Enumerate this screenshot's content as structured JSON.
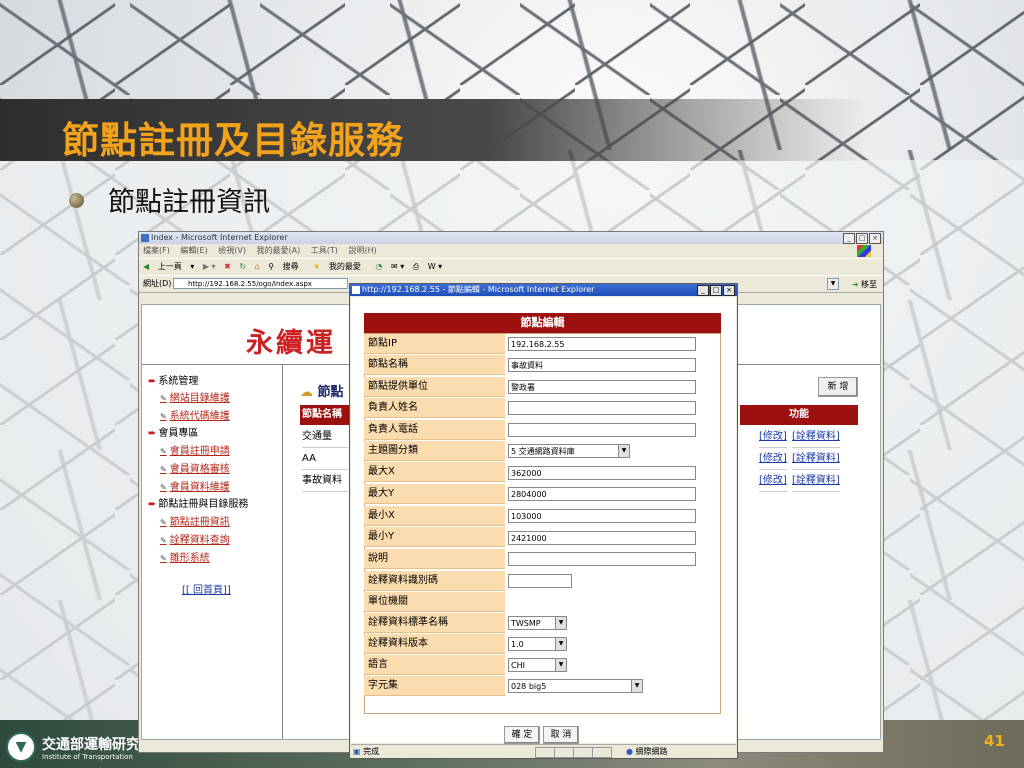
{
  "slide": {
    "title": "節點註冊及目錄服務",
    "bullet": "節點註冊資訊",
    "footer_org": "交通部運輸研究",
    "footer_org_en": "Institute of Transportation",
    "page_number": "41"
  },
  "ie_window": {
    "title": "Index - Microsoft Internet Explorer",
    "menu": [
      "檔案(F)",
      "編輯(E)",
      "檢視(V)",
      "我的最愛(A)",
      "工具(T)",
      "說明(H)"
    ],
    "toolbar": {
      "back": "上一頁",
      "search": "搜尋",
      "favorites": "我的最愛"
    },
    "address_label": "網址(D)",
    "address_url": "http://192.168.2.55/ogo/Index.aspx",
    "go_label": "移至",
    "banner_title": "永續運",
    "nav": {
      "system_mgmt": "系統管理",
      "site_directory": "網站目錄維護",
      "system_code": "系統代碼維護",
      "member_area": "會員專區",
      "member_register": "會員註冊申請",
      "member_review": "會員資格審核",
      "member_maintain": "會員資料維護",
      "node_reg_dir": "節點註冊與目錄服務",
      "node_reg_info": "節點註冊資訊",
      "metadata_query": "詮釋資料查詢",
      "geo_system": "雛形系統",
      "home_link": "[[ 回首頁]]"
    },
    "section_title": "節點",
    "new_button": "新 增",
    "table": {
      "col_node_name": "節點名稱",
      "col_function": "功能",
      "rows": [
        {
          "name": "交通量",
          "edit": "[修改]",
          "meta": "[詮釋資料]"
        },
        {
          "name": "AA",
          "edit": "[修改]",
          "meta": "[詮釋資料]"
        },
        {
          "name": "事故資料",
          "edit": "[修改]",
          "meta": "[詮釋資料]"
        }
      ]
    }
  },
  "popup": {
    "title": "http://192.168.2.55 - 節點編輯 - Microsoft Internet Explorer",
    "form_title": "節點編輯",
    "fields": {
      "node_ip": {
        "label": "節點IP",
        "value": "192.168.2.55"
      },
      "node_name": {
        "label": "節點名稱",
        "value": "事故資料"
      },
      "provider": {
        "label": "節點提供單位",
        "value": "警政署"
      },
      "contact_name": {
        "label": "負責人姓名",
        "value": ""
      },
      "contact_phone": {
        "label": "負責人電話",
        "value": ""
      },
      "theme": {
        "label": "主題圖分類",
        "value": "5 交通網路資料庫"
      },
      "max_x": {
        "label": "最大X",
        "value": "362000"
      },
      "max_y": {
        "label": "最大Y",
        "value": "2804000"
      },
      "min_x": {
        "label": "最小X",
        "value": "103000"
      },
      "min_y": {
        "label": "最小Y",
        "value": "2421000"
      },
      "description": {
        "label": "說明",
        "value": ""
      },
      "metadata_id": {
        "label": "詮釋資料識別碼",
        "value": ""
      },
      "unit_org": {
        "label": "單位機關",
        "value": ""
      },
      "metadata_std": {
        "label": "詮釋資料標準名稱",
        "value": "TWSMP"
      },
      "metadata_ver": {
        "label": "詮釋資料版本",
        "value": "1.0"
      },
      "language": {
        "label": "語言",
        "value": "CHI"
      },
      "charset": {
        "label": "字元集",
        "value": "028 big5"
      }
    },
    "ok_button": "確 定",
    "cancel_button": "取 消",
    "status_done": "完成",
    "status_zone": "網際網路"
  }
}
